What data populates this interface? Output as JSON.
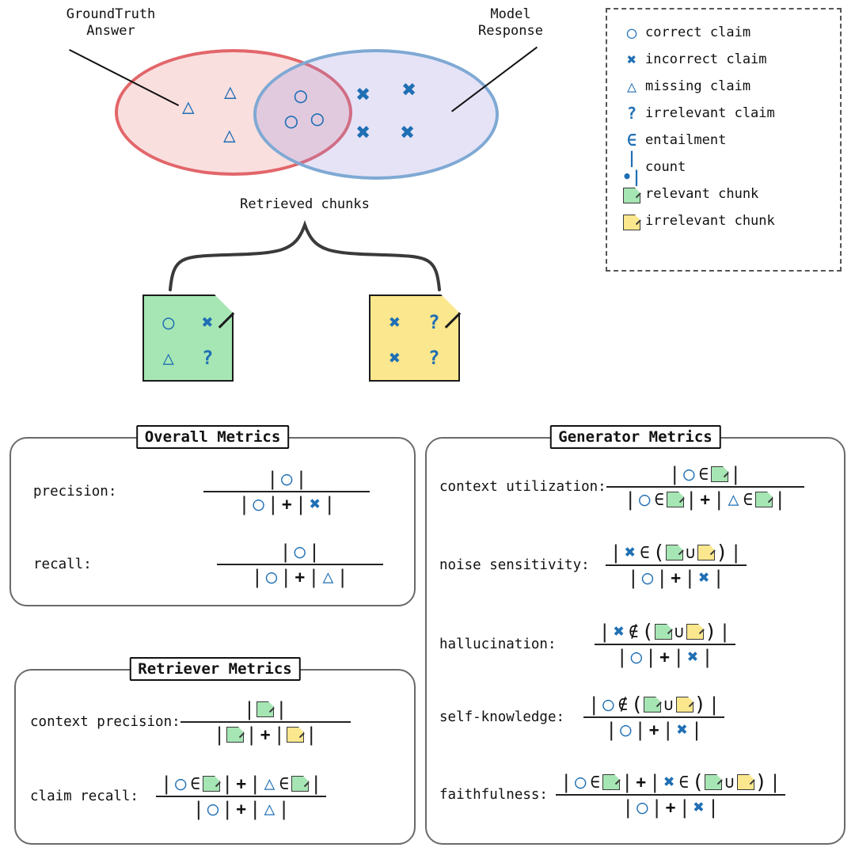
{
  "venn": {
    "groundtruth_label": "GroundTruth\nAnswer",
    "model_label": "Model\nResponse",
    "retrieved_label": "Retrieved chunks",
    "groundtruth_only_symbols": [
      "missing-claim",
      "missing-claim",
      "missing-claim"
    ],
    "intersection_symbols": [
      "correct-claim",
      "correct-claim",
      "correct-claim"
    ],
    "model_only_symbols": [
      "incorrect-claim",
      "incorrect-claim",
      "incorrect-claim",
      "incorrect-claim"
    ],
    "colors": {
      "groundtruth_fill": "#f7d8d8",
      "groundtruth_stroke": "#e2666a",
      "model_fill": "#e2ddf5",
      "model_stroke": "#7fa9d4",
      "symbol_blue": "#1f6fb4"
    }
  },
  "chunks": [
    {
      "name": "relevant-chunk",
      "color": "#a6e6b4",
      "symbols": [
        "◯",
        "✖",
        "△",
        "?"
      ]
    },
    {
      "name": "irrelevant-chunk",
      "color": "#fbe78d",
      "symbols": [
        "✖",
        "?",
        "✖",
        "?"
      ]
    }
  ],
  "legend": {
    "items": [
      {
        "glyph": "◯",
        "icon": "correct-claim-icon",
        "label": "correct claim"
      },
      {
        "glyph": "✖",
        "icon": "incorrect-claim-icon",
        "label": "incorrect claim"
      },
      {
        "glyph": "△",
        "icon": "missing-claim-icon",
        "label": "missing claim"
      },
      {
        "glyph": "?",
        "icon": "irrelevant-claim-icon",
        "label": "irrelevant claim"
      },
      {
        "glyph": "∈",
        "icon": "entailment-icon",
        "label": "entailment"
      },
      {
        "glyph": "|•|",
        "icon": "count-icon",
        "label": "count"
      },
      {
        "glyph": "chunk-green",
        "icon": "relevant-chunk-icon",
        "label": "relevant chunk"
      },
      {
        "glyph": "chunk-yellow",
        "icon": "irrelevant-chunk-icon",
        "label": "irrelevant chunk"
      }
    ]
  },
  "panels": {
    "overall": {
      "title": "Overall Metrics",
      "metrics": [
        {
          "name": "precision",
          "label": "precision:"
        },
        {
          "name": "recall",
          "label": "recall:"
        }
      ]
    },
    "retriever": {
      "title": "Retriever Metrics",
      "metrics": [
        {
          "name": "context-precision",
          "label": "context precision:"
        },
        {
          "name": "claim-recall",
          "label": "claim recall:"
        }
      ]
    },
    "generator": {
      "title": "Generator Metrics",
      "metrics": [
        {
          "name": "context-utilization",
          "label": "context utilization:"
        },
        {
          "name": "noise-sensitivity",
          "label": "noise sensitivity:"
        },
        {
          "name": "hallucination",
          "label": "hallucination:"
        },
        {
          "name": "self-knowledge",
          "label": "self-knowledge:"
        },
        {
          "name": "faithfulness",
          "label": "faithfulness:"
        }
      ]
    }
  },
  "symbols": {
    "circle": "◯",
    "cross": "✖",
    "triangle": "△",
    "question": "?",
    "in": "∈",
    "notin": "∉",
    "union": "∪",
    "plus": "+",
    "bar": "|",
    "lparen": "(",
    "rparen": ")"
  }
}
